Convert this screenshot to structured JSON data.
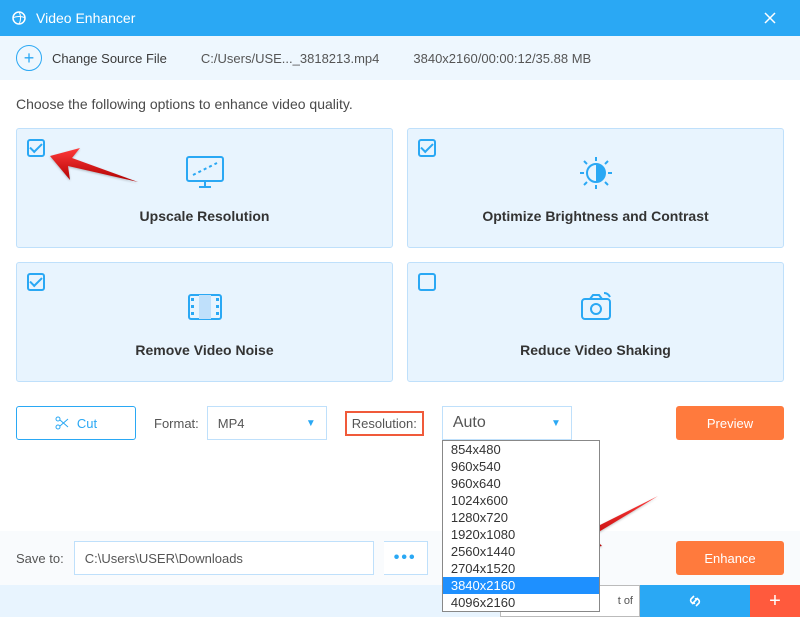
{
  "titlebar": {
    "title": "Video Enhancer"
  },
  "source": {
    "change_label": "Change Source File",
    "filepath": "C:/Users/USE..._3818213.mp4",
    "fileinfo": "3840x2160/00:00:12/35.88 MB"
  },
  "instruction": "Choose the following options to enhance video quality.",
  "cards": {
    "upscale": {
      "label": "Upscale Resolution",
      "checked": true
    },
    "brightness": {
      "label": "Optimize Brightness and Contrast",
      "checked": true
    },
    "noise": {
      "label": "Remove Video Noise",
      "checked": true
    },
    "shaking": {
      "label": "Reduce Video Shaking",
      "checked": false
    }
  },
  "toolbar": {
    "cut_label": "Cut",
    "format_label": "Format:",
    "format_value": "MP4",
    "resolution_label": "Resolution:",
    "resolution_value": "Auto",
    "preview_label": "Preview"
  },
  "resolution_options": [
    "854x480",
    "960x540",
    "960x640",
    "1024x600",
    "1280x720",
    "1920x1080",
    "2560x1440",
    "2704x1520",
    "3840x2160",
    "4096x2160"
  ],
  "resolution_selected": "3840x2160",
  "save": {
    "label": "Save to:",
    "path": "C:\\Users\\USER\\Downloads",
    "enhance_label": "Enhance",
    "browse": "•••"
  },
  "bottom": {
    "snippet": "t of"
  }
}
